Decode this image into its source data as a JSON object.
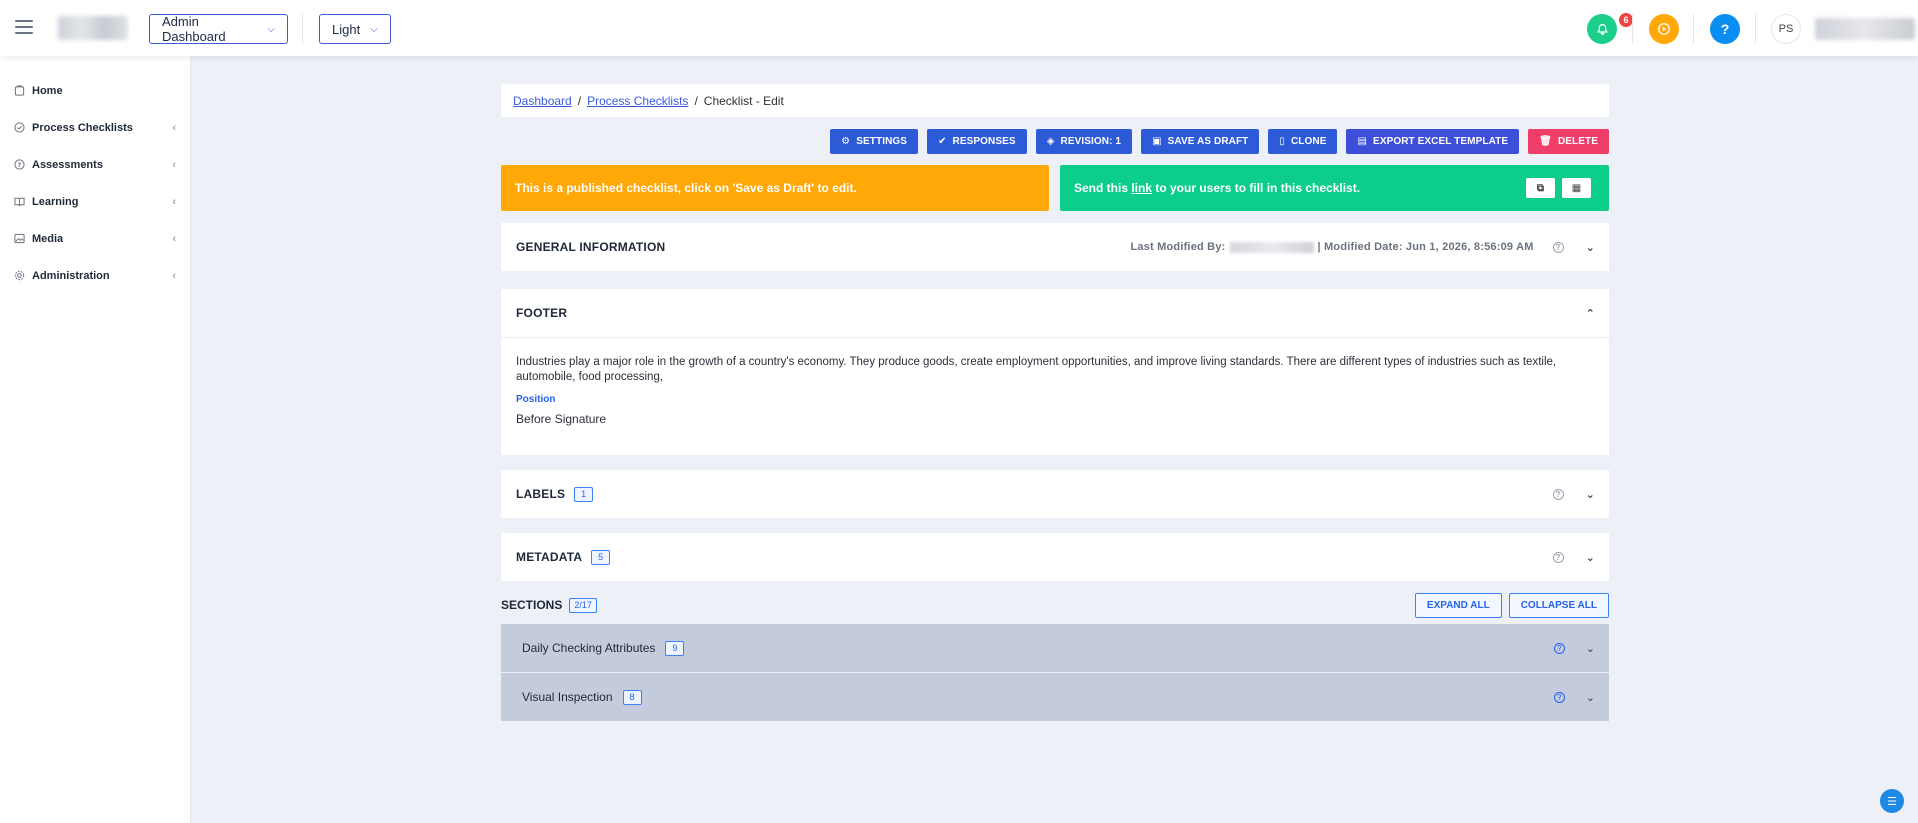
{
  "header": {
    "dashboard_select": "Admin Dashboard",
    "theme_select": "Light",
    "notification_count": "6",
    "help_label": "?",
    "avatar_initials": "PS",
    "icons": [
      "menu-icon",
      "bell-icon",
      "play-icon",
      "help-icon"
    ],
    "colors": {
      "bell": "#1bcf8b",
      "play": "#ffa808",
      "help": "#0a8ef2"
    }
  },
  "sidebar": {
    "items": [
      {
        "label": "Home",
        "icon": "home-icon",
        "caret": ""
      },
      {
        "label": "Process Checklists",
        "icon": "check-circle-icon",
        "caret": "‹"
      },
      {
        "label": "Assessments",
        "icon": "question-circle-icon",
        "caret": "‹"
      },
      {
        "label": "Learning",
        "icon": "book-icon",
        "caret": "‹"
      },
      {
        "label": "Media",
        "icon": "image-icon",
        "caret": "‹"
      },
      {
        "label": "Administration",
        "icon": "gear-icon",
        "caret": "‹"
      }
    ]
  },
  "breadcrumb": {
    "dashboard": "Dashboard",
    "process_checklists": "Process Checklists",
    "current": "Checklist - Edit",
    "separator": "/"
  },
  "toolbar": {
    "settings": "SETTINGS",
    "responses": "RESPONSES",
    "revision": "REVISION: 1",
    "save_draft": "SAVE AS DRAFT",
    "clone": "CLONE",
    "export": "EXPORT EXCEL TEMPLATE",
    "delete": "DELETE"
  },
  "alerts": {
    "published": "This is a published checklist, click on 'Save as Draft' to edit.",
    "send_prefix": "Send this ",
    "send_link": "link",
    "send_suffix": " to your users to fill in this checklist."
  },
  "general_info": {
    "title": "GENERAL INFORMATION",
    "last_modified_label": "Last Modified By:",
    "modified_date": "| Modified Date: Jun 1, 2026, 8:56:09 AM"
  },
  "footer_panel": {
    "title": "FOOTER",
    "text": "Industries play a major role in the growth of a country's economy. They produce goods, create employment opportunities, and improve living standards. There are different types of industries such as textile, automobile, food processing,",
    "position_label": "Position",
    "position_value": "Before Signature"
  },
  "labels_panel": {
    "title": "LABELS",
    "count": "1"
  },
  "metadata_panel": {
    "title": "METADATA",
    "count": "5"
  },
  "sections": {
    "title": "SECTIONS",
    "count": "2/17",
    "expand_all": "EXPAND ALL",
    "collapse_all": "COLLAPSE ALL",
    "items": [
      {
        "name": "Daily Checking Attributes",
        "count": "9"
      },
      {
        "name": "Visual Inspection",
        "count": "8"
      }
    ]
  }
}
